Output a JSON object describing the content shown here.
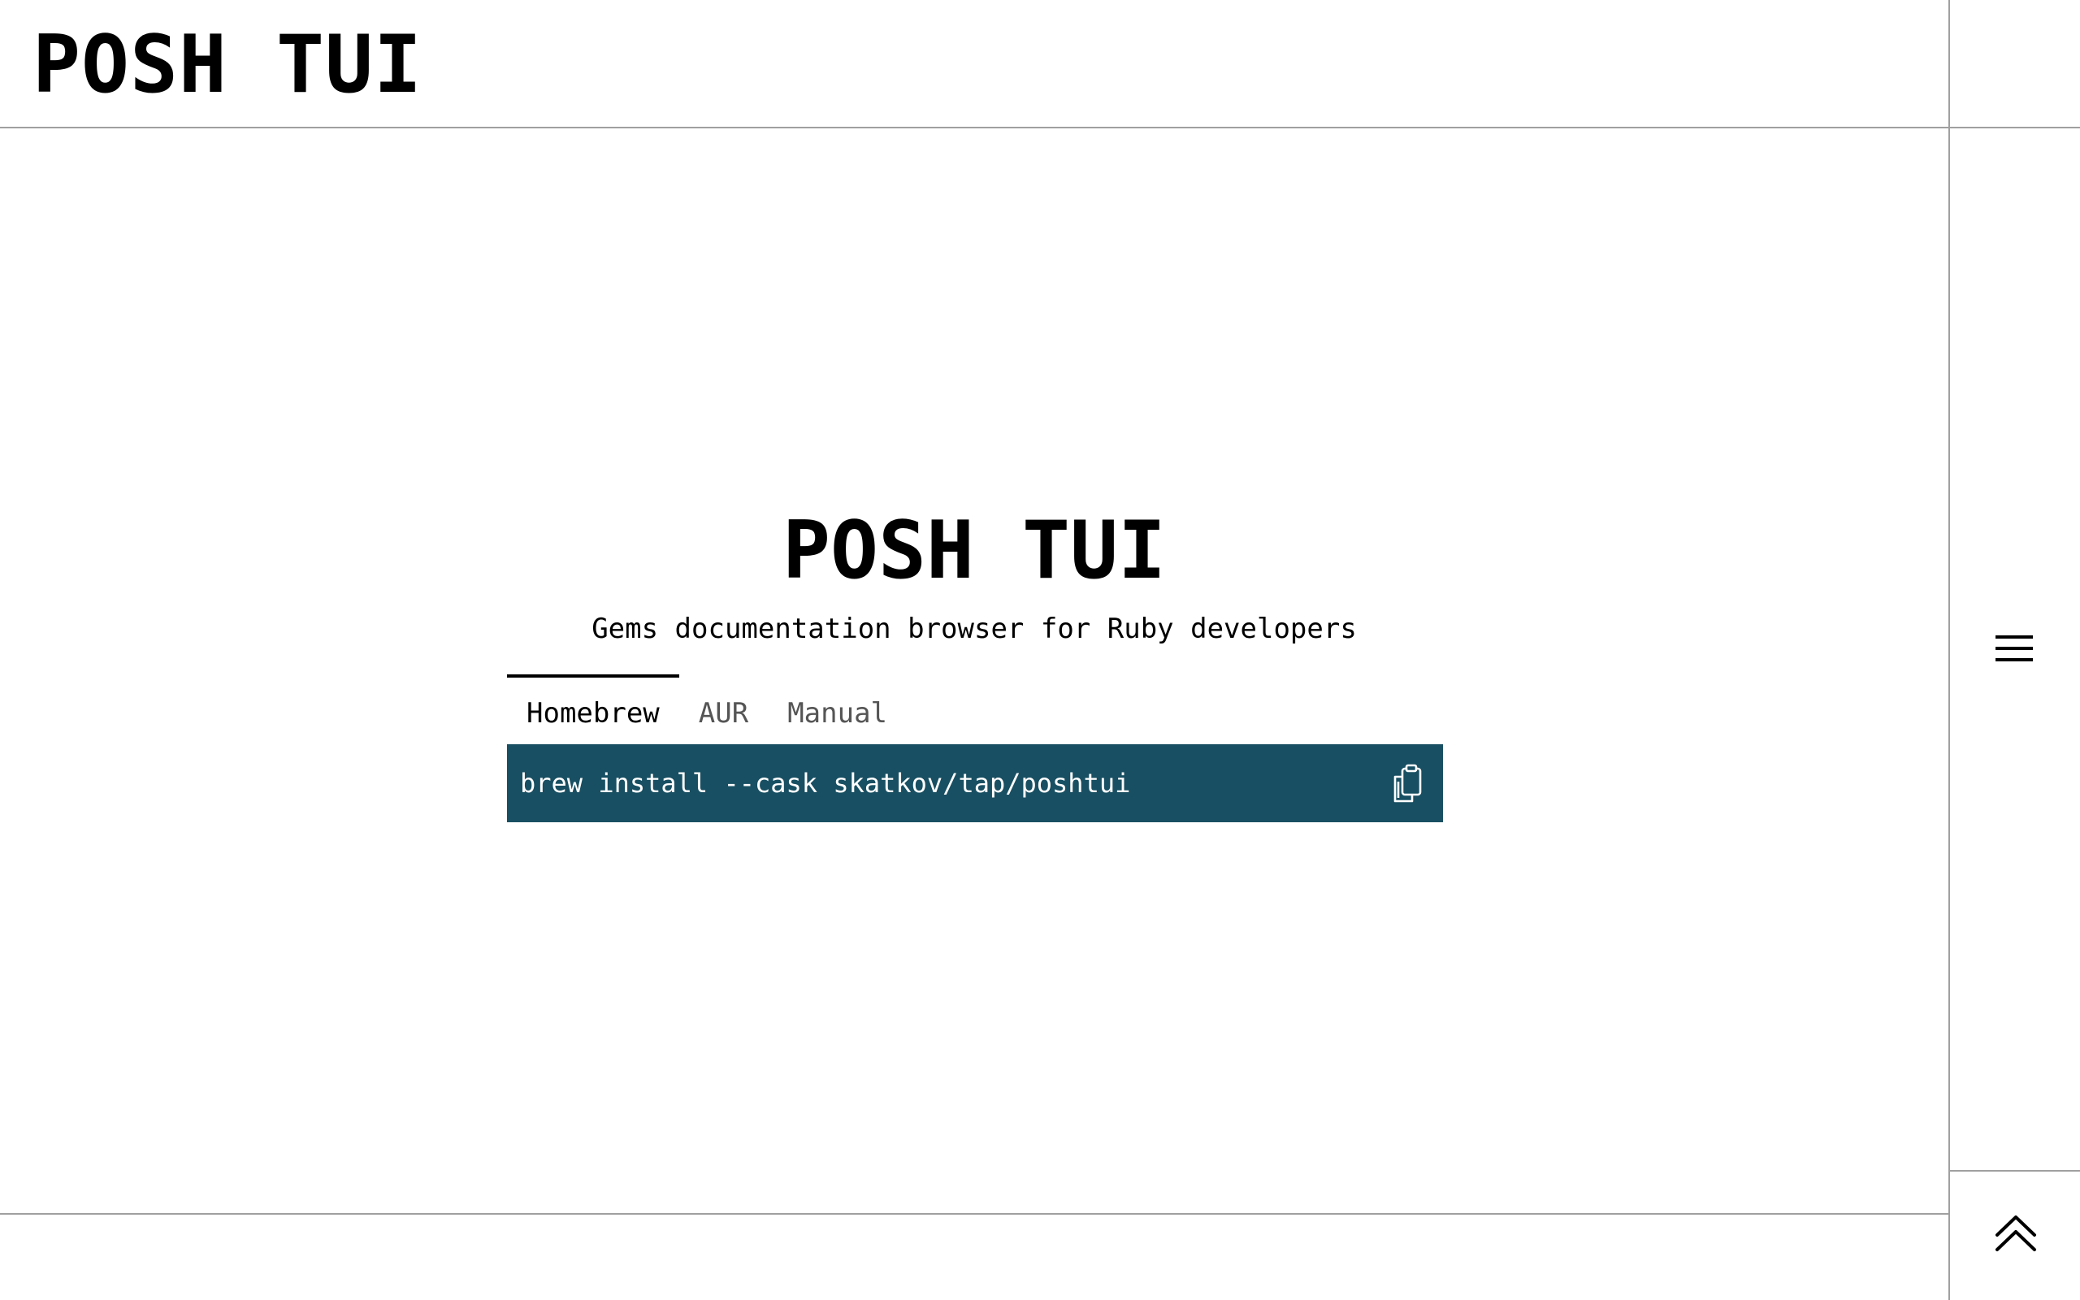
{
  "header": {
    "title": "POSH TUI"
  },
  "hero": {
    "title": "POSH TUI",
    "subtitle": "Gems documentation browser for Ruby developers"
  },
  "install": {
    "tabs": [
      {
        "label": "Homebrew",
        "active": true
      },
      {
        "label": "AUR",
        "active": false
      },
      {
        "label": "Manual",
        "active": false
      }
    ],
    "command": "brew install --cask skatkov/tap/poshtui",
    "copy_icon": "clipboard-icon"
  },
  "rail": {
    "menu_icon": "hamburger-menu-icon",
    "top_icon": "double-chevron-up-icon"
  },
  "colors": {
    "command_background": "#184f62",
    "command_text": "#ffffff",
    "rule": "#a0a0a0"
  }
}
